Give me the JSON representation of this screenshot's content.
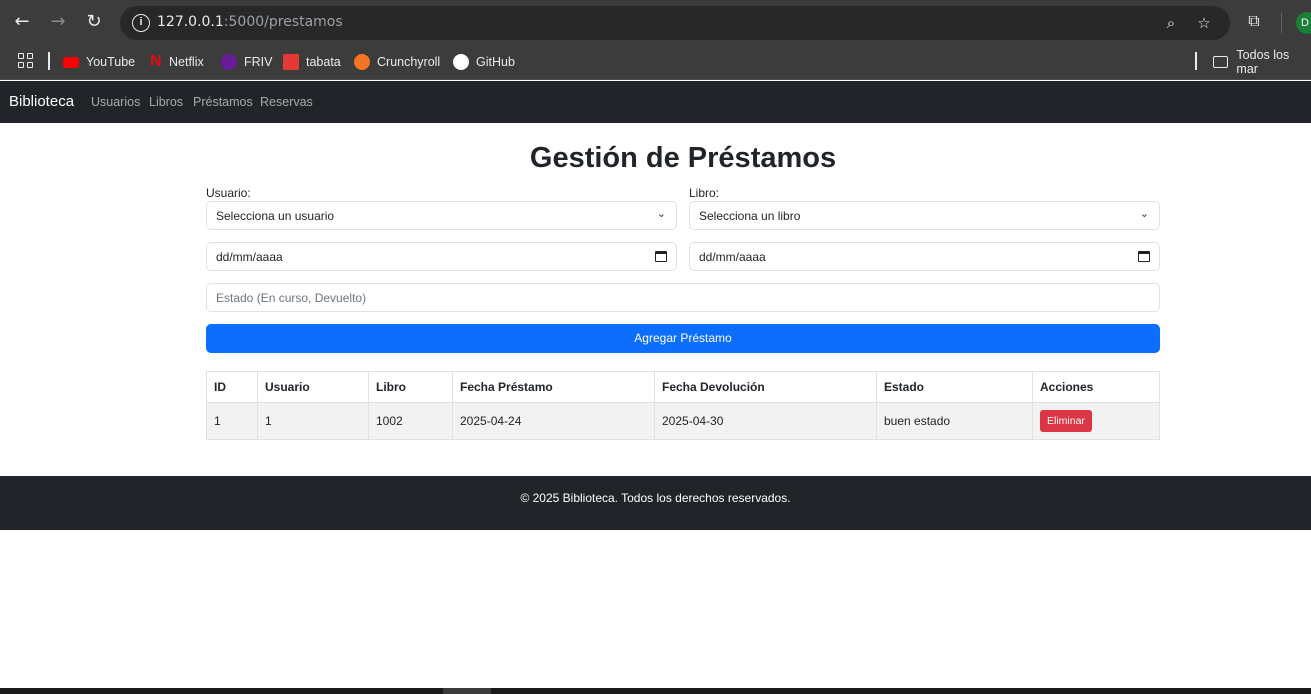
{
  "browser": {
    "url_host": "127.0.0.1",
    "url_path": ":5000/prestamos",
    "profile_initial": "D",
    "bookmarks": [
      {
        "label": "YouTube",
        "icon": "youtube-icon",
        "color": "#ff0000"
      },
      {
        "label": "Netflix",
        "icon": "netflix-icon",
        "color": "#e50914"
      },
      {
        "label": "FRIV",
        "icon": "friv-icon",
        "color": "#6a1b9a"
      },
      {
        "label": "tabata",
        "icon": "tabata-icon",
        "color": "#e53935"
      },
      {
        "label": "Crunchyroll",
        "icon": "crunchyroll-icon",
        "color": "#f47521"
      },
      {
        "label": "GitHub",
        "icon": "github-icon",
        "color": "#ffffff"
      }
    ],
    "bookmarks_folder": "Todos los mar"
  },
  "navbar": {
    "brand": "Biblioteca",
    "links": [
      "Usuarios",
      "Libros",
      "Préstamos",
      "Reservas"
    ]
  },
  "main": {
    "title": "Gestión de Préstamos",
    "usuario_label": "Usuario:",
    "usuario_select": "Selecciona un usuario",
    "libro_label": "Libro:",
    "libro_select": "Selecciona un libro",
    "fecha_prestamo_placeholder": "dd/mm/aaaa",
    "fecha_devolucion_placeholder": "dd/mm/aaaa",
    "estado_placeholder": "Estado (En curso, Devuelto)",
    "submit_label": "Agregar Préstamo"
  },
  "table": {
    "headers": [
      "ID",
      "Usuario",
      "Libro",
      "Fecha Préstamo",
      "Fecha Devolución",
      "Estado",
      "Acciones"
    ],
    "rows": [
      {
        "id": "1",
        "usuario": "1",
        "libro": "1002",
        "fecha_prestamo": "2025-04-24",
        "fecha_devolucion": "2025-04-30",
        "estado": "buen estado",
        "action": "Eliminar"
      }
    ]
  },
  "footer": {
    "text": "© 2025 Biblioteca. Todos los derechos reservados."
  },
  "colors": {
    "primary": "#0d6efd",
    "danger": "#dc3545",
    "navbar": "#212529"
  }
}
